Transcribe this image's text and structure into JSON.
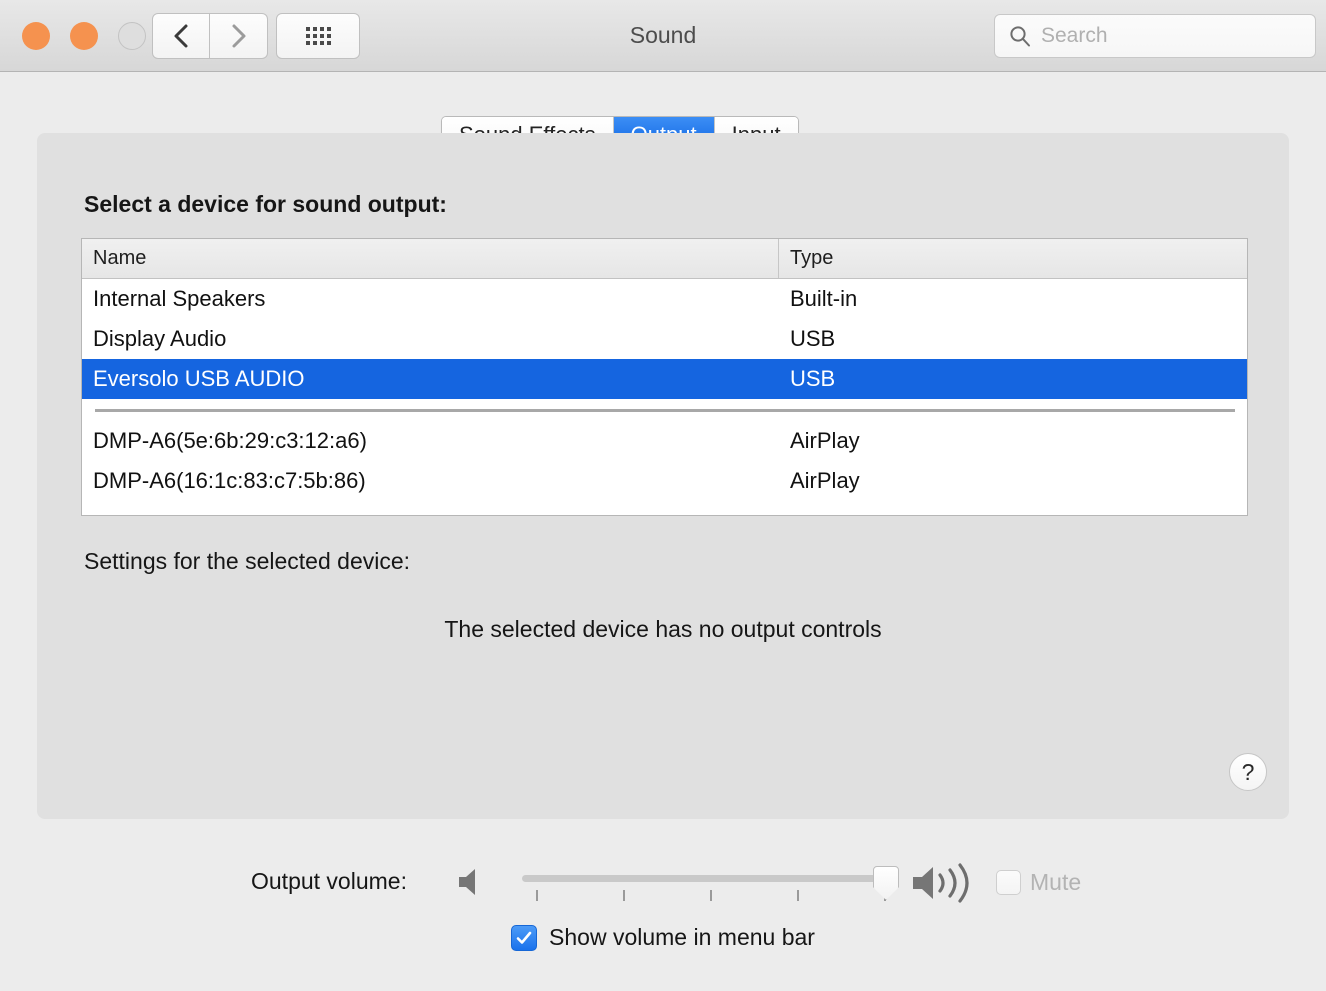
{
  "window": {
    "title": "Sound",
    "traffic_lights": [
      "close",
      "minimize",
      "zoom"
    ],
    "nav_back_icon": "chevron-left-icon",
    "nav_forward_icon": "chevron-right-icon",
    "grid_icon": "show-all-grid-icon",
    "accent_blue": "#1565e0",
    "traffic_orange": "#f5924f"
  },
  "search": {
    "placeholder": "Search",
    "value": "",
    "icon": "search-icon"
  },
  "tabs": [
    {
      "label": "Sound Effects",
      "active": false
    },
    {
      "label": "Output",
      "active": true
    },
    {
      "label": "Input",
      "active": false
    }
  ],
  "main": {
    "select_device_label": "Select a device for sound output:",
    "settings_label": "Settings for the selected device:",
    "no_controls_message": "The selected device has no output controls",
    "help_label": "?"
  },
  "device_table": {
    "columns": [
      "Name",
      "Type"
    ],
    "rows": [
      {
        "name": "Internal Speakers",
        "type": "Built-in",
        "selected": false
      },
      {
        "name": "Display Audio",
        "type": "USB",
        "selected": false
      },
      {
        "name": "Eversolo USB AUDIO",
        "type": "USB",
        "selected": true
      },
      {
        "separator": true
      },
      {
        "name": "DMP-A6(5e:6b:29:c3:12:a6)",
        "type": "AirPlay",
        "selected": false
      },
      {
        "name": "DMP-A6(16:1c:83:c7:5b:86)",
        "type": "AirPlay",
        "selected": false
      }
    ]
  },
  "volume": {
    "label": "Output volume:",
    "value_percent": 100,
    "tick_count": 5,
    "low_icon": "speaker-quiet-icon",
    "high_icon": "speaker-loud-icon",
    "mute_label": "Mute",
    "mute_checked": false,
    "mute_disabled": true
  },
  "menu_bar_option": {
    "label": "Show volume in menu bar",
    "checked": true
  }
}
